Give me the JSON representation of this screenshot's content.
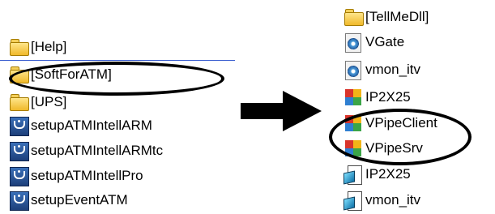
{
  "left_panel": {
    "items": [
      {
        "label": "[Help]",
        "icon": "folder-icon"
      },
      {
        "label": "[SoftForATM]",
        "icon": "folder-icon"
      },
      {
        "label": "[UPS]",
        "icon": "folder-icon"
      },
      {
        "label": "setupATMIntellARM",
        "icon": "setup-icon"
      },
      {
        "label": "setupATMIntellARMtc",
        "icon": "setup-icon"
      },
      {
        "label": "setupATMIntellPro",
        "icon": "setup-icon"
      },
      {
        "label": "setupEventATM",
        "icon": "setup-icon"
      }
    ],
    "highlighted": "[SoftForATM]"
  },
  "arrow": {
    "direction": "right",
    "icon": "arrow-right-icon"
  },
  "right_panel": {
    "items": [
      {
        "label": "[TellMeDll]",
        "icon": "folder-icon"
      },
      {
        "label": "VGate",
        "icon": "dll-icon"
      },
      {
        "label": "vmon_itv",
        "icon": "dll-icon"
      },
      {
        "label": "IP2X25",
        "icon": "exe-icon"
      },
      {
        "label": "VPipeClient",
        "icon": "exe-icon"
      },
      {
        "label": "VPipeSrv",
        "icon": "exe-icon"
      },
      {
        "label": "IP2X25",
        "icon": "cube-icon"
      },
      {
        "label": "vmon_itv",
        "icon": "cube-icon"
      }
    ],
    "highlighted": [
      "VPipeClient",
      "VPipeSrv"
    ]
  },
  "colors": {
    "background": "#ffffff",
    "selection_line": "#3c5fd0",
    "callout_stroke": "#000000"
  }
}
